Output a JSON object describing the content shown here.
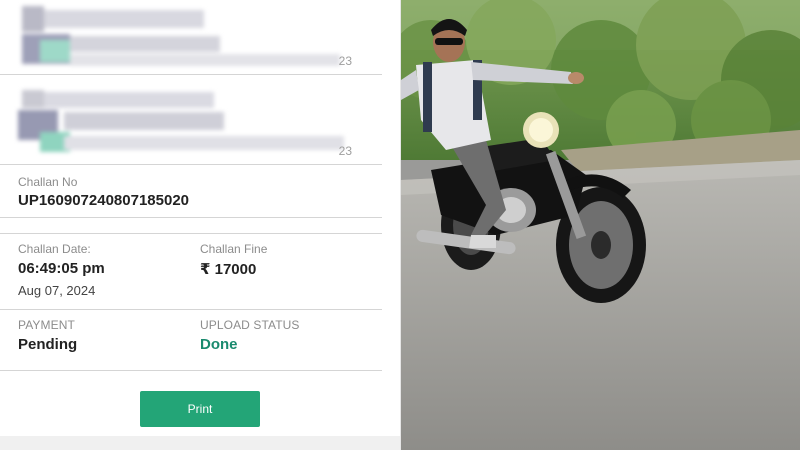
{
  "challan": {
    "number_label": "Challan No",
    "number_value": "UP160907240807185020",
    "date_label": "Challan Date:",
    "time_value": "06:49:05 pm",
    "date_value": "Aug 07, 2024",
    "fine_label": "Challan Fine",
    "fine_value": "₹ 17000",
    "payment_label": "PAYMENT",
    "payment_value": "Pending",
    "upload_label": "UPLOAD STATUS",
    "upload_value": "Done",
    "print_label": "Print"
  },
  "blurred_rows": [
    {
      "tail": "23"
    },
    {
      "tail": "23"
    }
  ],
  "colors": {
    "accent": "#23a577",
    "status_done": "#1a8a6e",
    "divider": "#d5d5d5"
  },
  "photo": {
    "subject": "man riding a black motorcycle with arms outstretched on a road"
  }
}
